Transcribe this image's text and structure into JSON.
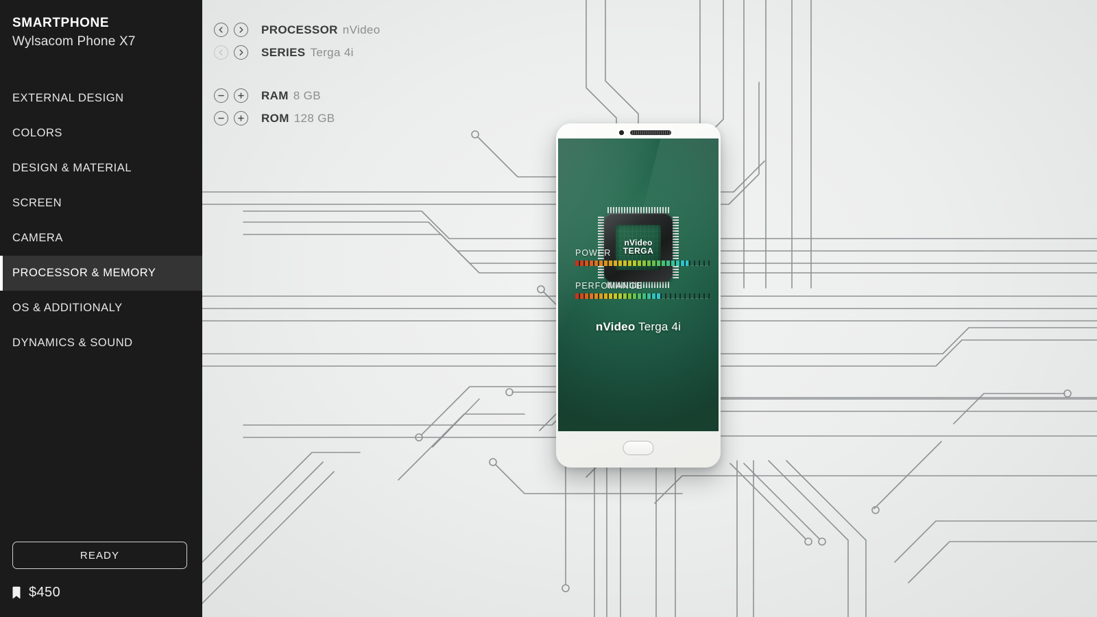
{
  "sidebar": {
    "brand_title": "SMARTPHONE",
    "brand_model": "Wylsacom Phone X7",
    "items": [
      {
        "label": "EXTERNAL DESIGN",
        "active": false
      },
      {
        "label": "COLORS",
        "active": false
      },
      {
        "label": "DESIGN & MATERIAL",
        "active": false
      },
      {
        "label": "SCREEN",
        "active": false
      },
      {
        "label": "CAMERA",
        "active": false
      },
      {
        "label": "PROCESSOR & MEMORY",
        "active": true
      },
      {
        "label": "OS & ADDITIONALY",
        "active": false
      },
      {
        "label": "DYNAMICS & SOUND",
        "active": false
      }
    ],
    "ready_label": "READY",
    "price_icon": "price-tag-icon",
    "price_value": "$450",
    "background_color": "#1b1b1b",
    "active_item_color": "#343434"
  },
  "controls": {
    "selectors": [
      {
        "label": "PROCESSOR",
        "value": "nVideo",
        "prev_icon": "chevron-left-icon",
        "next_icon": "chevron-right-icon",
        "prev_disabled": false,
        "next_disabled": false
      },
      {
        "label": "SERIES",
        "value": "Terga 4i",
        "prev_icon": "chevron-left-icon",
        "next_icon": "chevron-right-icon",
        "prev_disabled": true,
        "next_disabled": false
      }
    ],
    "steppers": [
      {
        "label": "RAM",
        "value": "8 GB",
        "minus_icon": "minus-circle-icon",
        "plus_icon": "plus-circle-icon"
      },
      {
        "label": "ROM",
        "value": "128 GB",
        "minus_icon": "minus-circle-icon",
        "plus_icon": "plus-circle-icon"
      }
    ]
  },
  "phone": {
    "camera_icon": "front-camera-icon",
    "speaker_icon": "earpiece-speaker-icon",
    "home_button_icon": "home-button-icon",
    "chip": {
      "die_line1": "nVideo",
      "die_line2": "TERGA",
      "pins_icon": "chip-pins-icon"
    },
    "title_bold": "nVideo",
    "title_light": "Terga 4i",
    "meters": [
      {
        "label": "POWER",
        "percent": 84
      },
      {
        "label": "PERFOMANCE",
        "percent": 63
      }
    ],
    "screen_color": "#24654c"
  },
  "background": {
    "type": "circuit-board-traces",
    "trace_color": "#8f9293",
    "base_color": "#e9eaea"
  }
}
